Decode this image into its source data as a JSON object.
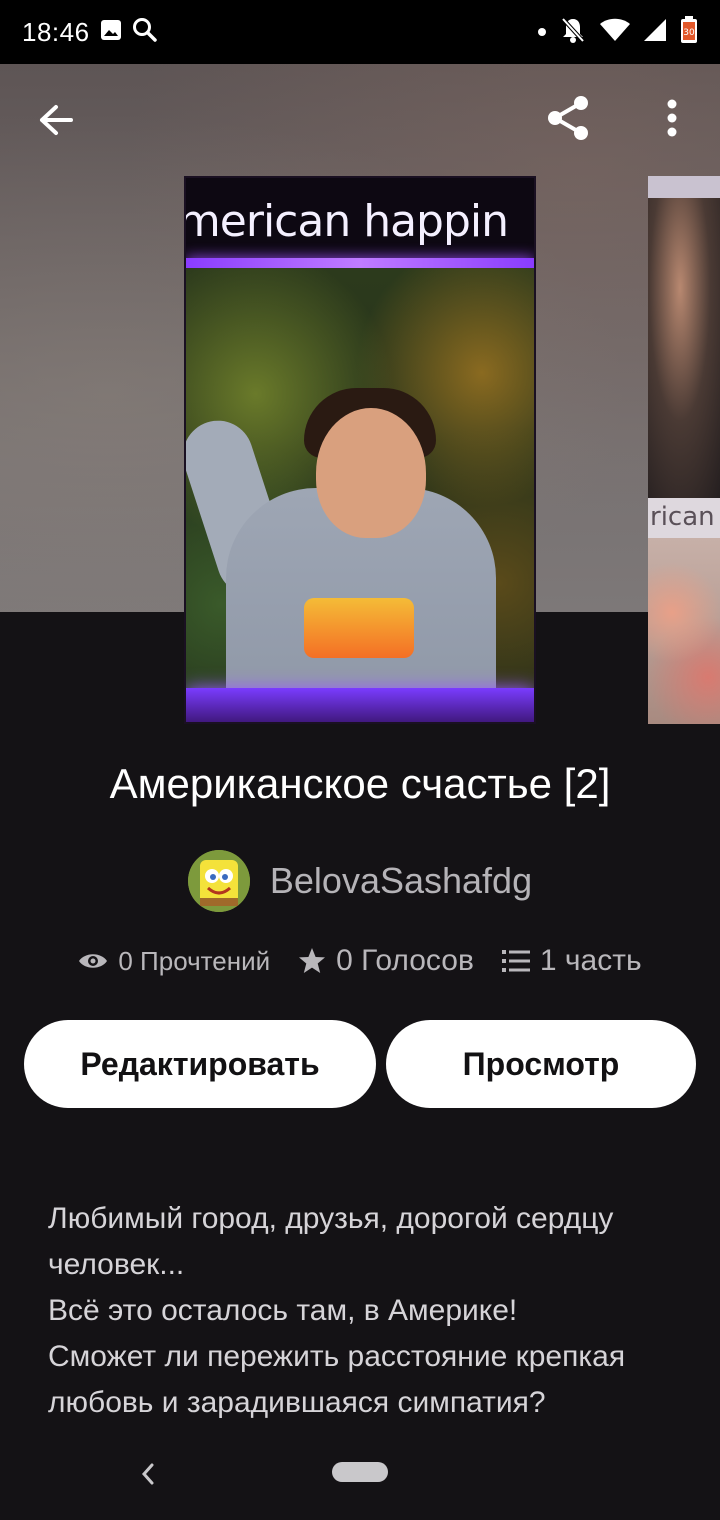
{
  "status_bar": {
    "time": "18:46",
    "left_icons": [
      "image-icon",
      "search-icon"
    ],
    "right_icons": [
      "notification-dot",
      "bell-off-icon",
      "wifi-icon",
      "signal-icon",
      "battery-icon"
    ],
    "battery_level": "30"
  },
  "top_bar": {
    "back_icon": "arrow-left-icon",
    "share_icon": "share-icon",
    "more_icon": "more-vertical-icon"
  },
  "cover": {
    "title_text": "american happin",
    "side_title_text": "rican h"
  },
  "story": {
    "title": "Американское счастье [2]",
    "author": "BelovaSashafdg"
  },
  "stats": {
    "reads": "0 Прочтений",
    "votes": "0 Голосов",
    "parts": "1 часть"
  },
  "actions": {
    "edit_label": "Редактировать",
    "view_label": "Просмотр"
  },
  "description": {
    "lines": [
      "Любимый город, друзья, дорогой сердцу человек...",
      "Всё это осталось там, в Америке!",
      "Сможет ли пережить расстояние крепкая любовь и зарадившаяся симпатия?"
    ]
  },
  "colors": {
    "background": "#141215",
    "button_bg": "#ffffff",
    "button_text": "#121113",
    "muted_text": "#b9b7bb"
  }
}
